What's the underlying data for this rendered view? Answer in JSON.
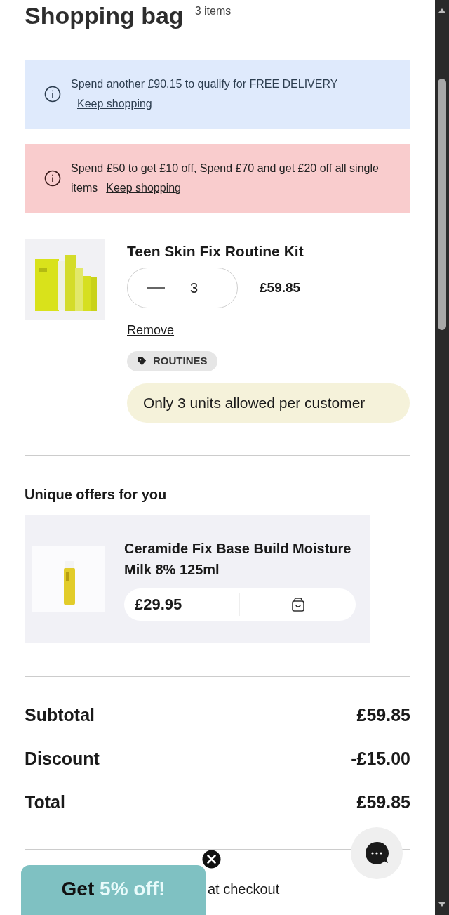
{
  "header": {
    "title": "Shopping bag",
    "count": "3 items"
  },
  "alerts": [
    {
      "kind": "info",
      "color": "#dfeafc",
      "text": "Spend another £90.15 to qualify for FREE DELIVERY",
      "link": "Keep shopping",
      "link_newline": true
    },
    {
      "kind": "promo",
      "color": "#f9cccd",
      "text": "Spend £50 to get £10 off, Spend £70 and get £20 off all single items",
      "link": "Keep shopping",
      "link_newline": false
    }
  ],
  "cart_item": {
    "name": "Teen Skin Fix Routine Kit",
    "quantity": "3",
    "price": "£59.85",
    "remove": "Remove",
    "tag": "ROUTINES",
    "limit_note": "Only 3 units allowed per customer"
  },
  "offers": {
    "title": "Unique offers for you",
    "items": [
      {
        "name": "Ceramide Fix Base Build Moisture Milk 8% 125ml",
        "price": "£29.95"
      }
    ]
  },
  "summary": [
    {
      "label": "Subtotal",
      "value": "£59.85"
    },
    {
      "label": "Discount",
      "value": "-£15.00"
    },
    {
      "label": "Total",
      "value": "£59.85"
    }
  ],
  "checkout_note": "at checkout",
  "popup": {
    "lead": "Get",
    "highlight": "5% off!"
  }
}
